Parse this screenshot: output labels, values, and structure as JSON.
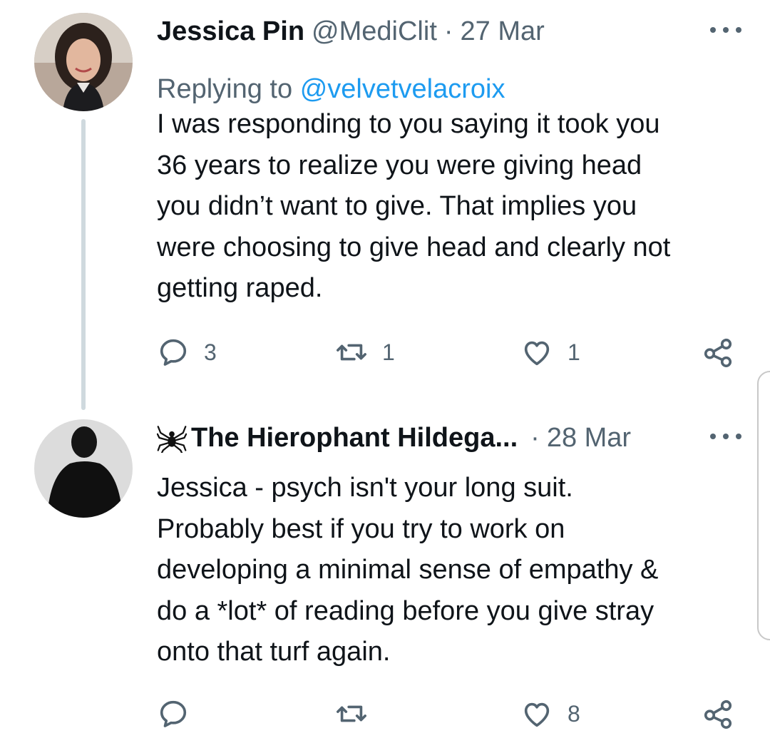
{
  "tweets": [
    {
      "name": "Jessica Pin",
      "handle": "@MediClit",
      "separator": "·",
      "date": "27 Mar",
      "reply_prefix": "Replying to",
      "reply_to": "@velvetvelacroix",
      "text_lines": [
        "I was responding to you saying it took you",
        "36 years to realize you were giving head",
        "you didn’t want to give. That implies you",
        "were choosing to give head and clearly not",
        "getting raped."
      ],
      "reply_count": "3",
      "retweet_count": "1",
      "like_count": "1",
      "icons": [
        "reply-icon",
        "retweet-icon",
        "like-icon",
        "share-icon",
        "more-icon"
      ]
    },
    {
      "name_emoji_icon": "spider-icon",
      "name": "The Hierophant Hildega...",
      "separator": "·",
      "date": "28 Mar",
      "text_lines": [
        "Jessica - psych isn't your long suit.",
        "Probably best if you try to work on",
        "developing a minimal sense of empathy &",
        "do a *lot* of reading before you give stray",
        "onto that turf again."
      ],
      "reply_count": "",
      "retweet_count": "",
      "like_count": "8",
      "icons": [
        "reply-icon",
        "retweet-icon",
        "like-icon",
        "share-icon",
        "more-icon"
      ]
    }
  ],
  "colors": {
    "text": "#0f1419",
    "secondary": "#536471",
    "link": "#1d9bf0",
    "thread_line": "#cfd9de"
  }
}
